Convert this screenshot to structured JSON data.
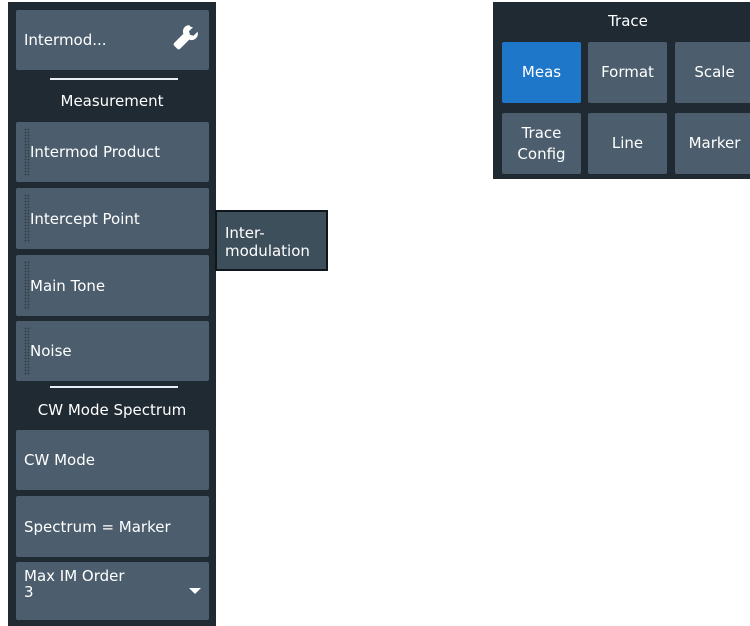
{
  "softkey_panel": {
    "top_button": {
      "label": "Intermod...",
      "icon": "wrench-icon"
    },
    "section_measurement": {
      "title": "Measurement",
      "buttons": [
        {
          "label": "Intermod Product"
        },
        {
          "label": "Intercept Point"
        },
        {
          "label": "Main Tone"
        },
        {
          "label": "Noise"
        }
      ]
    },
    "section_cw": {
      "title": "CW Mode Spectrum",
      "buttons": [
        {
          "label": "CW Mode"
        },
        {
          "label": "Spectrum = Marker"
        }
      ],
      "dropdown": {
        "label": "Max IM Order",
        "value": "3"
      }
    }
  },
  "tooltip": {
    "text": "Inter-\nmodulation"
  },
  "trace_panel": {
    "title": "Trace",
    "buttons": [
      {
        "label": "Meas",
        "active": true
      },
      {
        "label": "Format"
      },
      {
        "label": "Scale"
      },
      {
        "label": "Trace\nConfig"
      },
      {
        "label": "Line"
      },
      {
        "label": "Marker"
      }
    ]
  },
  "colors": {
    "panel_bg": "#1f2a33",
    "button_bg": "#4c5e6d",
    "active_blue": "#1f77c9",
    "text": "#ffffff"
  }
}
